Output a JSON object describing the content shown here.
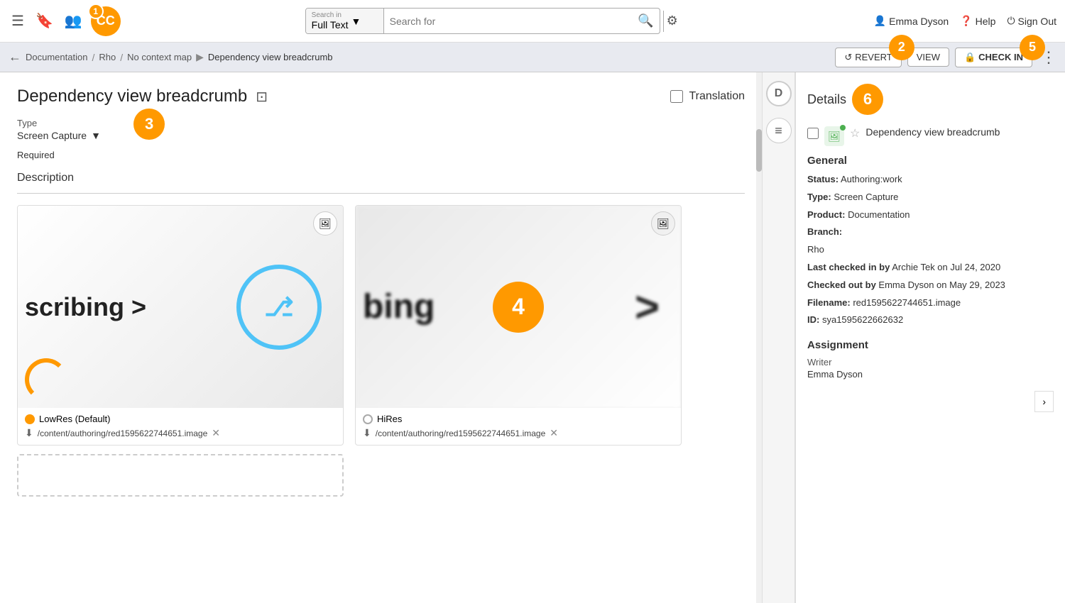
{
  "topNav": {
    "menuIcon": "☰",
    "bookmarkIcon": "🔖",
    "peopleIcon": "👥",
    "logoText": "CC",
    "searchIn": {
      "label": "Search in",
      "type": "Full Text",
      "placeholder": "Search for"
    },
    "user": {
      "name": "Emma Dyson"
    },
    "helpLabel": "Help",
    "signOutLabel": "Sign Out"
  },
  "breadcrumb": {
    "backIcon": "←",
    "path": [
      {
        "text": "Documentation",
        "sep": "/"
      },
      {
        "text": "Rho",
        "sep": "/"
      },
      {
        "text": "No context map",
        "sep": "▶"
      }
    ],
    "current": "Dependency view breadcrumb",
    "revertLabel": "REVERT",
    "viewLabel": "VIEW",
    "checkInLabel": "CHECK IN"
  },
  "content": {
    "title": "Dependency view breadcrumb",
    "splitIcon": "⊡",
    "translationLabel": "Translation",
    "typeLabel": "Type",
    "typeValue": "Screen Capture",
    "requiredLabel": "Required",
    "descriptionLabel": "Description",
    "images": [
      {
        "resolution": "LowRes (Default)",
        "resolutionActive": true,
        "filePath": "/content/authoring/red1595622744651.image"
      },
      {
        "resolution": "HiRes",
        "resolutionActive": false,
        "filePath": "/content/authoring/red1595622744651.image"
      }
    ]
  },
  "sidePanel": {
    "dLabel": "D",
    "listIcon": "≡"
  },
  "details": {
    "title": "Details",
    "itemName": "Dependency view breadcrumb",
    "general": {
      "title": "General",
      "status": "Authoring:work",
      "type": "Screen Capture",
      "product": "Documentation",
      "branchLabel": "Branch:",
      "branch": "Rho",
      "lastCheckedInBy": "Archie Tek on Jul 24, 2020",
      "checkedOutBy": "Emma Dyson on May 29, 2023",
      "filename": "red1595622744651.image",
      "id": "sya1595622662632"
    },
    "assignment": {
      "title": "Assignment",
      "role": "Writer",
      "name": "Emma Dyson"
    }
  },
  "numbers": {
    "n1": "1",
    "n2": "2",
    "n3": "3",
    "n4": "4",
    "n5": "5",
    "n6": "6"
  }
}
